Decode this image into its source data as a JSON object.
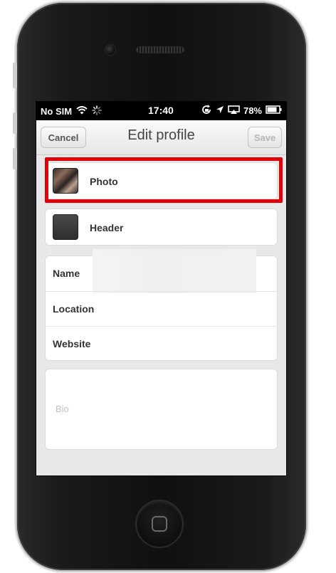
{
  "status_bar": {
    "carrier": "No SIM",
    "time": "17:40",
    "battery": "78%"
  },
  "nav": {
    "cancel_label": "Cancel",
    "title": "Edit profile",
    "save_label": "Save"
  },
  "photo_row": {
    "label": "Photo"
  },
  "header_row": {
    "label": "Header"
  },
  "fields": {
    "name_label": "Name",
    "location_label": "Location",
    "website_label": "Website"
  },
  "bio": {
    "placeholder": "Bio"
  },
  "colors": {
    "highlight": "#e0000a",
    "screen_bg": "#e8e8e8",
    "phone_body": "#141414"
  },
  "icons": [
    "wifi-icon",
    "loading-spinner-icon",
    "rotation-lock-icon",
    "location-arrow-icon",
    "airplay-icon",
    "battery-icon"
  ]
}
